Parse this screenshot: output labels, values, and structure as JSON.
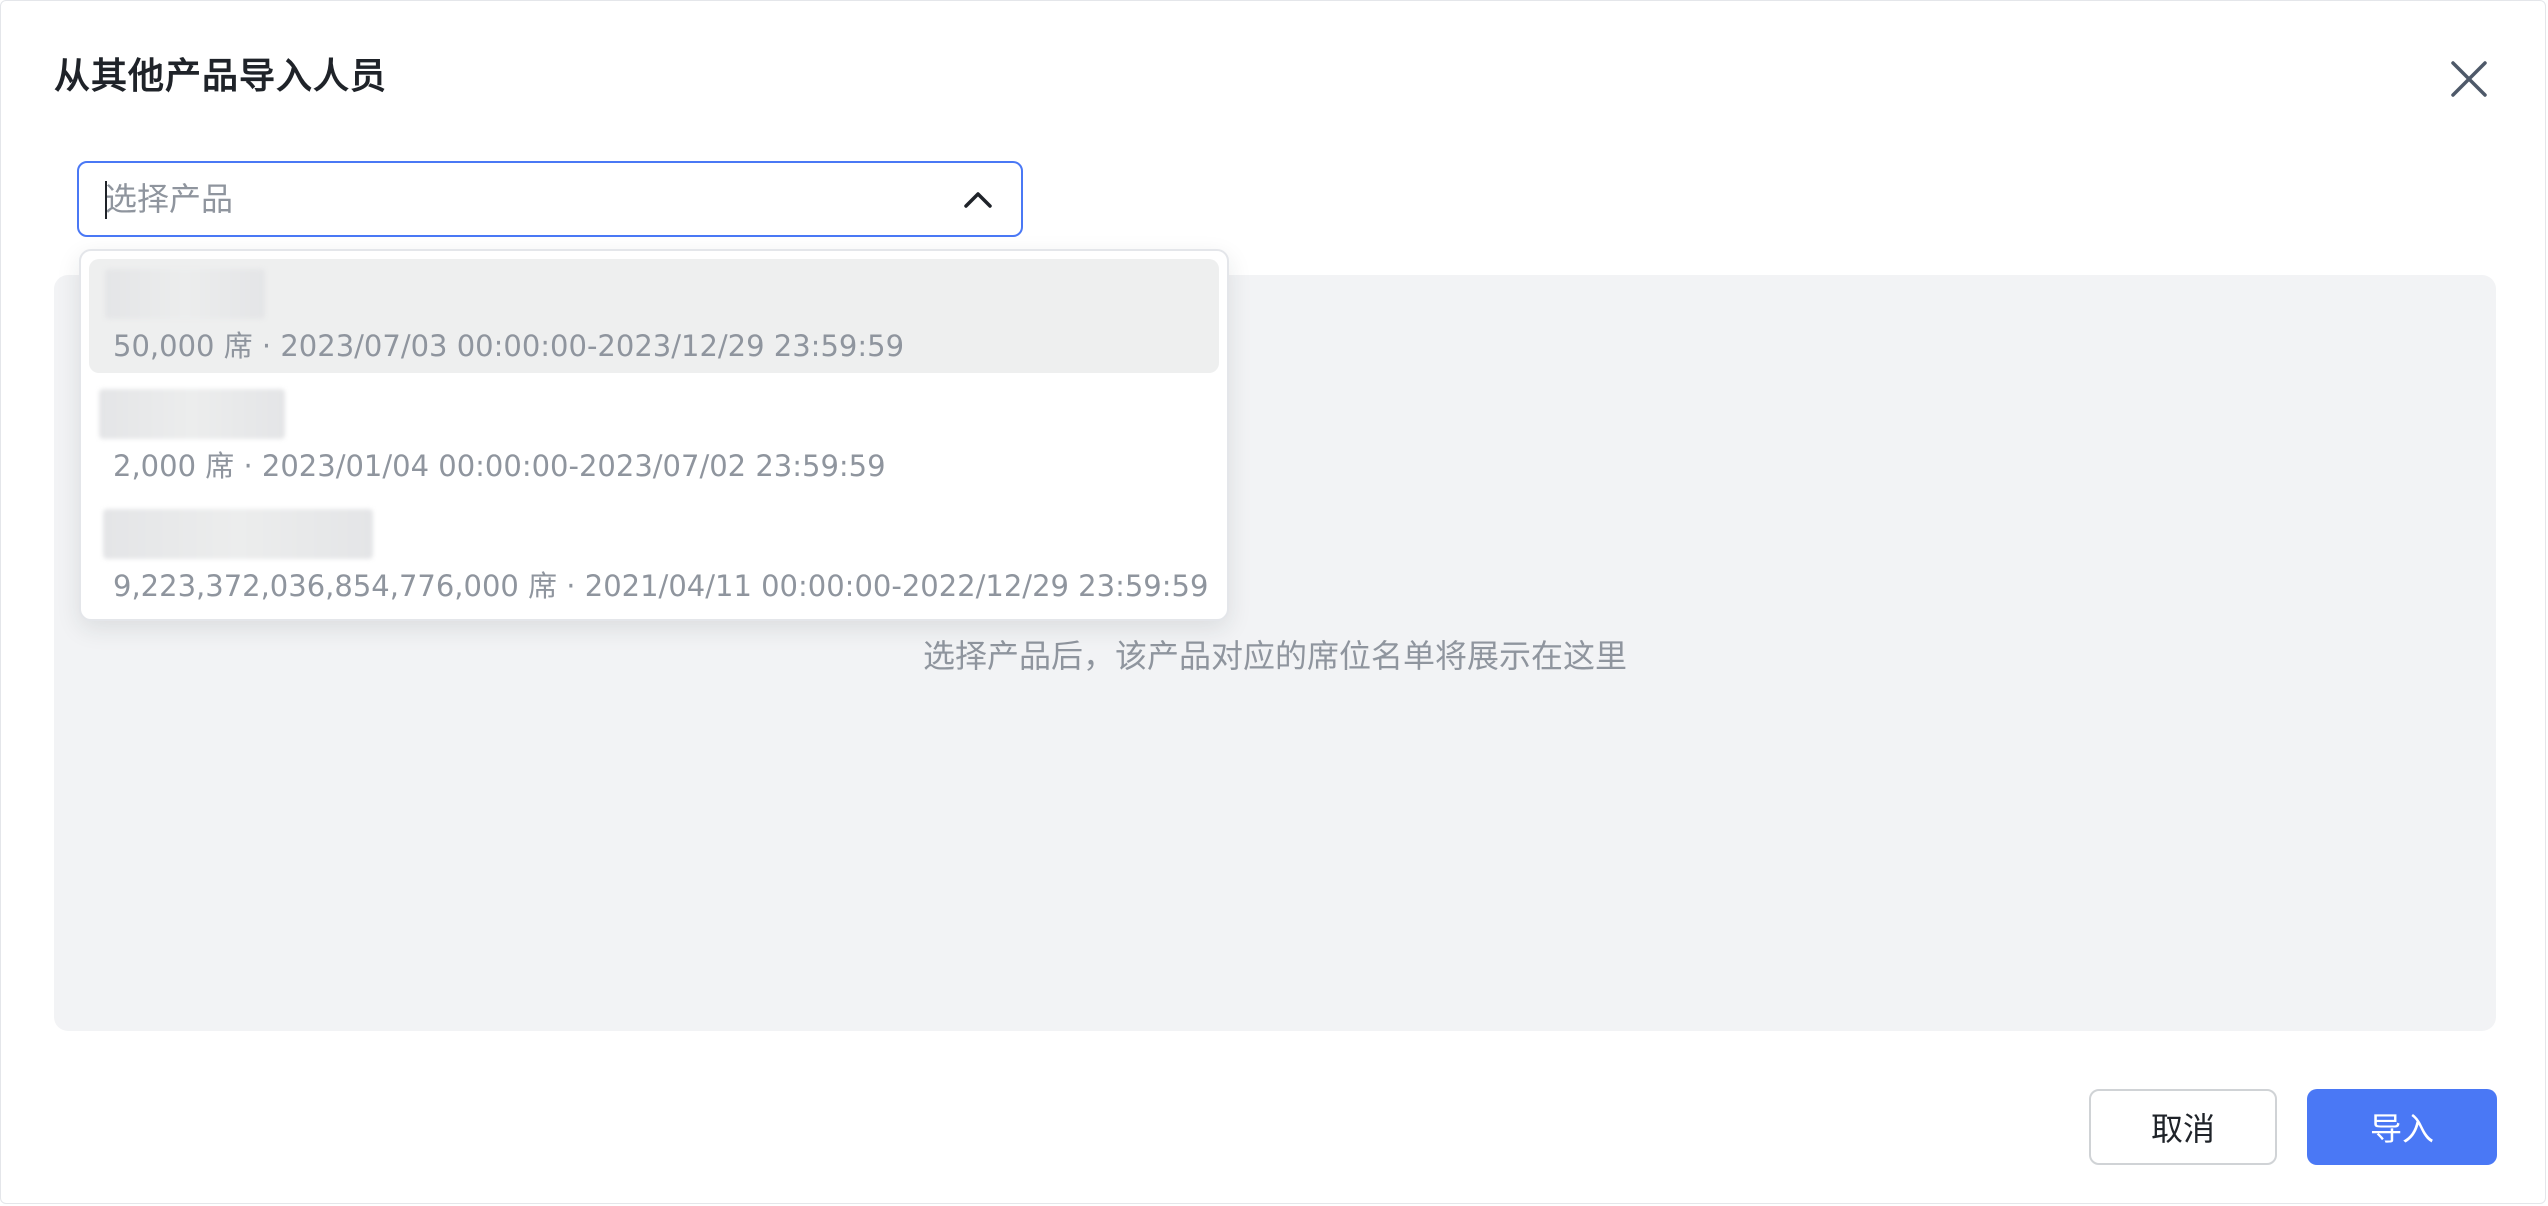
{
  "dialog": {
    "title": "从其他产品导入人员",
    "close_icon": "close-icon"
  },
  "select": {
    "placeholder": "选择产品",
    "value": "",
    "chevron_icon": "chevron-up-icon",
    "accent_color": "#4a78f5"
  },
  "dropdown": {
    "options": [
      {
        "meta": "50,000 席 · 2023/07/03 00:00:00-2023/12/29 23:59:59",
        "active": true
      },
      {
        "meta": "2,000 席 · 2023/01/04 00:00:00-2023/07/02 23:59:59",
        "active": false
      },
      {
        "meta": "9,223,372,036,854,776,000 席 · 2021/04/11 00:00:00-2022/12/29 23:59:59",
        "active": false
      }
    ]
  },
  "empty_state": {
    "text": "选择产品后，该产品对应的席位名单将展示在这里"
  },
  "footer": {
    "cancel_label": "取消",
    "import_label": "导入"
  }
}
